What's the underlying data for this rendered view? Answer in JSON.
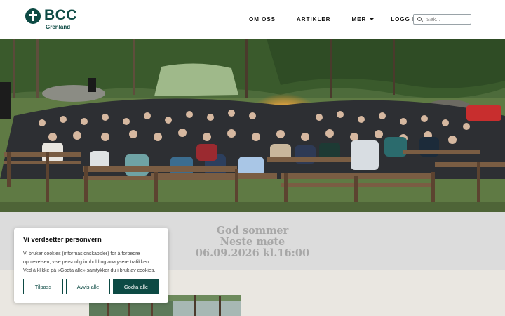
{
  "brand": {
    "name": "BCC",
    "subtitle": "Grenland",
    "color": "#0d4a44"
  },
  "nav": {
    "items": [
      "OM OSS",
      "ARTIKLER",
      "MER",
      "LOGG INN"
    ]
  },
  "search": {
    "placeholder": "Søk..."
  },
  "hero": {
    "image": "campfire-gathering-photo"
  },
  "banner": {
    "line1": "God sommer",
    "line2": "Neste møte",
    "line3": "06.09.2026 kl.16:00"
  },
  "cookie": {
    "title": "Vi verdsetter personvern",
    "line1": "Vi bruker cookies (informasjonskapsler) for å forbedre",
    "line2": "opplevelsen, vise personlig innhold og analysere trafikken.",
    "line3": "Ved å klikke på «Godta alle» samtykker du i bruk av cookies.",
    "customize": "Tilpass",
    "reject": "Avvis alle",
    "accept": "Godta alle"
  }
}
